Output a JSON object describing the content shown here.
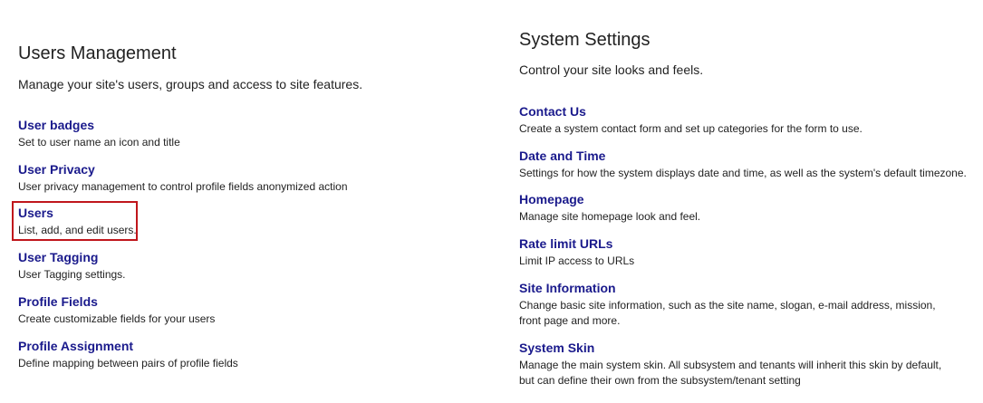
{
  "users_management": {
    "title": "Users Management",
    "description": "Manage your site's users, groups and access to site features.",
    "items": [
      {
        "label": "User badges",
        "description": "Set to user name an icon and title"
      },
      {
        "label": "User Privacy",
        "description": "User privacy management to control profile fields anonymized action"
      },
      {
        "label": "Users",
        "description": "List, add, and edit users."
      },
      {
        "label": "User Tagging",
        "description": "User Tagging settings."
      },
      {
        "label": "Profile Fields",
        "description": "Create customizable fields for your users"
      },
      {
        "label": "Profile Assignment",
        "description": "Define mapping between pairs of profile fields"
      }
    ]
  },
  "system_settings": {
    "title": "System Settings",
    "description": "Control your site looks and feels.",
    "items": [
      {
        "label": "Contact Us",
        "description": "Create a system contact form and set up categories for the form to use."
      },
      {
        "label": "Date and Time",
        "description": "Settings for how the system displays date and time, as well as the system's default timezone."
      },
      {
        "label": "Homepage",
        "description": "Manage site homepage look and feel."
      },
      {
        "label": "Rate limit URLs",
        "description": "Limit IP access to URLs"
      },
      {
        "label": "Site Information",
        "description": "Change basic site information, such as the site name, slogan, e-mail address, mission, front page and more."
      },
      {
        "label": "System Skin",
        "description": "Manage the main system skin. All subsystem and tenants will inherit this skin by default, but can define their own from the subsystem/tenant setting"
      }
    ]
  },
  "colors": {
    "link": "#1a1a8c",
    "text": "#222222",
    "highlight_border": "#c0161c"
  }
}
